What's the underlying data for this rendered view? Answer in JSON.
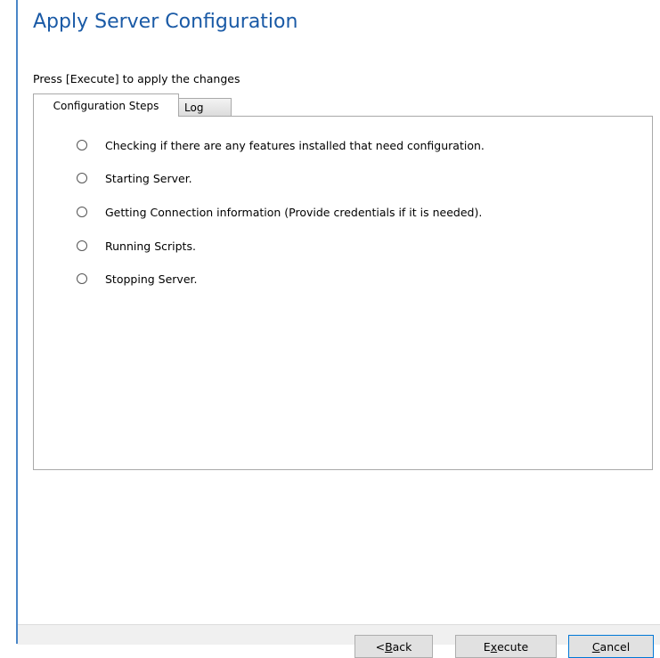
{
  "page": {
    "title": "Apply Server Configuration",
    "instruction": "Press [Execute] to apply the changes"
  },
  "tabs": [
    {
      "label": "Configuration Steps",
      "active": true
    },
    {
      "label": "Log",
      "active": false
    }
  ],
  "steps": [
    {
      "label": "Checking if there are any features installed that need configuration.",
      "checked": false
    },
    {
      "label": "Starting Server.",
      "checked": false
    },
    {
      "label": "Getting Connection information (Provide credentials if it is needed).",
      "checked": false
    },
    {
      "label": "Running Scripts.",
      "checked": false
    },
    {
      "label": "Stopping Server.",
      "checked": false
    }
  ],
  "buttons": {
    "back": {
      "pre": "< ",
      "accel": "B",
      "post": "ack"
    },
    "execute": {
      "pre": "E",
      "accel": "x",
      "post": "ecute"
    },
    "cancel": {
      "pre": "",
      "accel": "C",
      "post": "ancel"
    }
  },
  "colors": {
    "title": "#1a5aa6",
    "accent_border": "#4a86c8"
  }
}
